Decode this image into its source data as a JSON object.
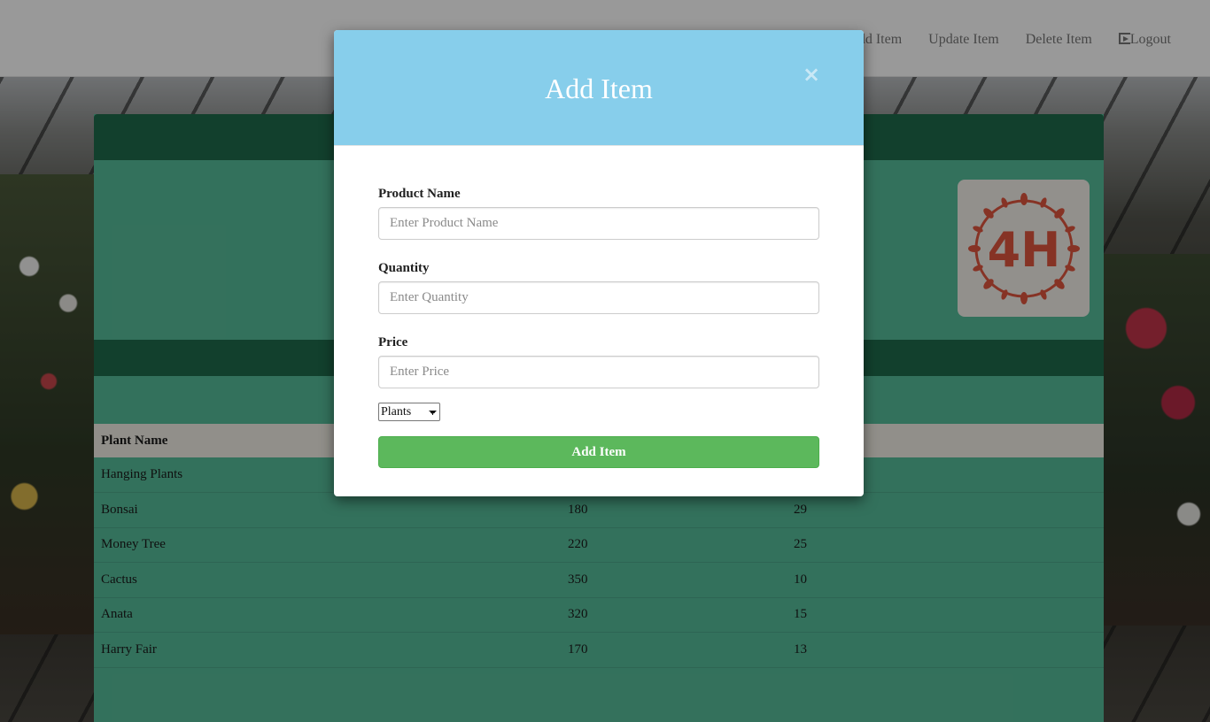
{
  "nav": {
    "items": [
      {
        "label": "Add Item"
      },
      {
        "label": "Update Item"
      },
      {
        "label": "Delete Item"
      },
      {
        "label": "Logout",
        "icon": "logout-icon"
      }
    ]
  },
  "brand": {
    "logo_text": "4H"
  },
  "table": {
    "header": {
      "col1": "Plant Name",
      "col2": "",
      "col3": ""
    },
    "rows": [
      {
        "name": "Hanging Plants",
        "price": "",
        "qty": ""
      },
      {
        "name": "Bonsai",
        "price": "180",
        "qty": "29"
      },
      {
        "name": "Money Tree",
        "price": "220",
        "qty": "25"
      },
      {
        "name": "Cactus",
        "price": "350",
        "qty": "10"
      },
      {
        "name": "Anata",
        "price": "320",
        "qty": "15"
      },
      {
        "name": "Harry Fair",
        "price": "170",
        "qty": "13"
      }
    ]
  },
  "modal": {
    "title": "Add Item",
    "close": "×",
    "product_label": "Product Name",
    "product_placeholder": "Enter Product Name",
    "quantity_label": "Quantity",
    "quantity_placeholder": "Enter Quantity",
    "price_label": "Price",
    "price_placeholder": "Enter Price",
    "category_selected": "Plants",
    "submit_label": "Add Item"
  },
  "colors": {
    "modal_header": "#87ceeb",
    "submit_button": "#5cb85c",
    "panel": "#56bd9a",
    "panel_dark": "#1e6b4c",
    "logo_red": "#e0563f"
  }
}
